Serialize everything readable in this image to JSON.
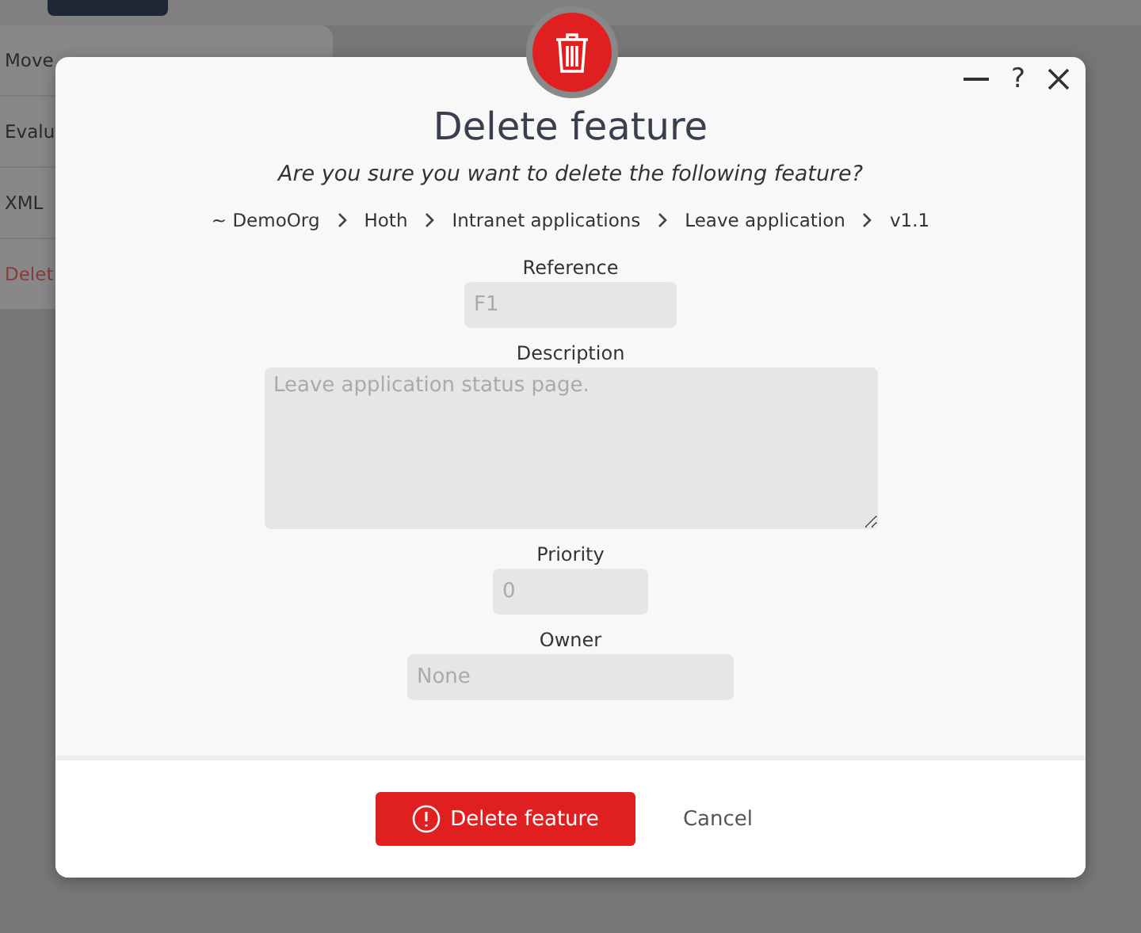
{
  "background": {
    "menu_items": [
      {
        "label": "Move",
        "kind": "normal"
      },
      {
        "label": "Evalu",
        "kind": "normal"
      },
      {
        "label": "XML",
        "kind": "normal"
      },
      {
        "label": "Delet",
        "kind": "danger"
      }
    ]
  },
  "dialog": {
    "title": "Delete feature",
    "question": "Are you sure you want to delete the following feature?",
    "help": "?",
    "breadcrumb": [
      "~ DemoOrg",
      "Hoth",
      "Intranet applications",
      "Leave application",
      "v1.1"
    ],
    "fields": [
      {
        "label": "Reference",
        "kind": "input",
        "value": "F1",
        "disabled": true
      },
      {
        "label": "Description",
        "kind": "textarea",
        "value": "Leave application status page.",
        "disabled": true
      },
      {
        "label": "Priority",
        "kind": "input",
        "value": "0",
        "disabled": true
      },
      {
        "label": "Owner",
        "kind": "input",
        "value": "None",
        "disabled": true
      }
    ],
    "confirm": "Delete feature",
    "cancel": "Cancel"
  }
}
